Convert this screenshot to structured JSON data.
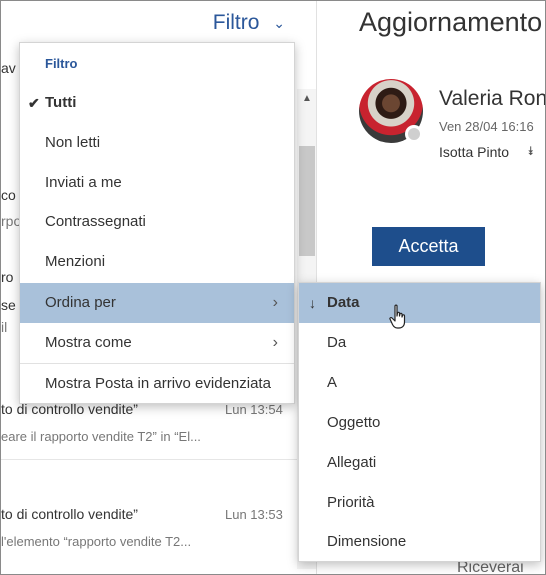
{
  "list_pane": {
    "filter_label": "Filtro",
    "fragments": {
      "tab_text": "av",
      "item1_line1": "co",
      "item1_line2": "rpo",
      "item2_line1": "ro",
      "item3_line1": "se",
      "item3_line2": "il",
      "item4_subject": "to di controllo vendite”",
      "item4_time": "Lun 13:54",
      "item4_preview": "eare il rapporto vendite T2” in “El...",
      "item5_subject": "to di controllo vendite”",
      "item5_time": "Lun 13:53",
      "item5_preview": "l'elemento “rapporto vendite T2..."
    }
  },
  "reading_pane": {
    "subject": "Aggiornamento",
    "sender_name": "Valeria Ron",
    "sent_date": "Ven 28/04 16:16",
    "recipient": "Isotta Pinto",
    "accept_label": "Accetta",
    "bottom_text": "Riceverai"
  },
  "filter_menu": {
    "heading": "Filtro",
    "items": [
      {
        "label": "Tutti",
        "checked": true
      },
      {
        "label": "Non letti"
      },
      {
        "label": "Inviati a me"
      },
      {
        "label": "Contrassegnati"
      },
      {
        "label": "Menzioni"
      },
      {
        "label": "Ordina per",
        "submenu": true,
        "highlighted": true
      },
      {
        "label": "Mostra come",
        "submenu": true
      },
      {
        "label": "Mostra Posta in arrivo evidenziata"
      }
    ]
  },
  "sort_menu": {
    "items": [
      {
        "label": "Data",
        "active": true,
        "sort_direction": "descending"
      },
      {
        "label": "Da"
      },
      {
        "label": "A"
      },
      {
        "label": "Oggetto"
      },
      {
        "label": "Allegati"
      },
      {
        "label": "Priorità"
      },
      {
        "label": "Dimensione"
      }
    ]
  },
  "colors": {
    "accent": "#2b579a",
    "button": "#1e4e8c",
    "highlight": "#a9c1da"
  }
}
